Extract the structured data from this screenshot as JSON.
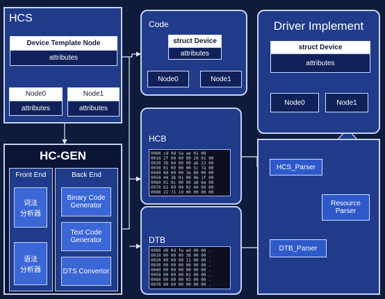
{
  "hcs": {
    "title": "HCS",
    "template_node": "Device Template Node",
    "attributes": "attributes",
    "node0": "Node0",
    "node1": "Node1",
    "node0_attributes": "attributes",
    "node1_attributes": "attributes"
  },
  "hcgen": {
    "title": "HC-GEN",
    "front_end": "Front End",
    "back_end": "Back End",
    "lexer": "词法\n分析器",
    "parser": "语法\n分析器",
    "binary": "Binary Code Generator",
    "text": "Text Code Generator",
    "dts": "DTS Convertor"
  },
  "code": {
    "title": "Code",
    "struct": "struct Device",
    "attributes": "attributes",
    "node0": "Node0",
    "node1": "Node1"
  },
  "hcb": {
    "title": "HCB"
  },
  "dtb": {
    "title": "DTB"
  },
  "driver": {
    "title": "Driver Implement",
    "struct": "struct Device",
    "attributes": "attributes",
    "node0": "Node0",
    "node1": "Node1"
  },
  "parsers": {
    "hcs_parser": "HCS_Parser",
    "dtb_parser": "DTB_Parser",
    "resource_parser": "Resource Parser"
  },
  "colors": {
    "background": "#0f1b3a",
    "panel": "#1f3b8a",
    "dark": "#102159",
    "node": "#3b66d6",
    "border": "#c7d3f3"
  }
}
